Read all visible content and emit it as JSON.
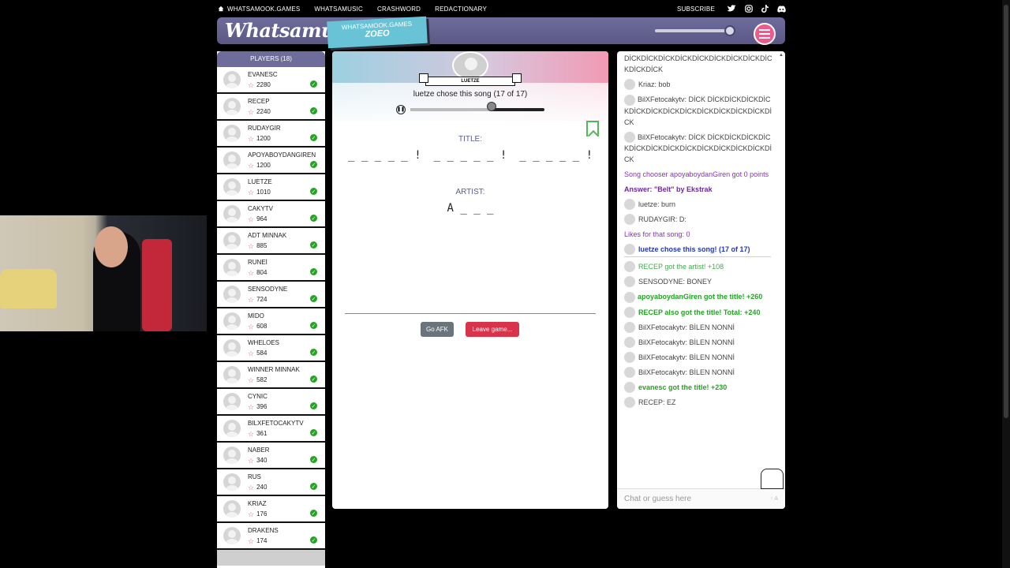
{
  "topnav": {
    "items": [
      "WHATSAMOOK.GAMES",
      "WHATSAMUSIC",
      "CRASHWORD",
      "REDACTIONARY"
    ],
    "subscribe": "SUBSCRIBE",
    "socials": [
      "twitter-icon",
      "instagram-icon",
      "tiktok-icon",
      "discord-icon"
    ]
  },
  "header": {
    "logo": "Whatsamusic",
    "tag_line1": "WHATSAMOOK.GAMES",
    "tag_line2": "ZOEO"
  },
  "players": {
    "title": "PLAYERS (18)",
    "list": [
      {
        "name": "EVANESC",
        "score": "2280"
      },
      {
        "name": "RECEP",
        "score": "2240"
      },
      {
        "name": "RUDAYGIR",
        "score": "1200"
      },
      {
        "name": "APOYABOYDANGIREN",
        "score": "1200"
      },
      {
        "name": "LUETZE",
        "score": "1010"
      },
      {
        "name": "CAKYTV",
        "score": "964"
      },
      {
        "name": "ADT MINNAK",
        "score": "885"
      },
      {
        "name": "RUNEİ",
        "score": "804"
      },
      {
        "name": "SENSODYNE",
        "score": "724"
      },
      {
        "name": "MIDO",
        "score": "608"
      },
      {
        "name": "WHELOES",
        "score": "584"
      },
      {
        "name": "WINNER MINNAK",
        "score": "582"
      },
      {
        "name": "CYNIC",
        "score": "396"
      },
      {
        "name": "BILXFETOCAKYTV",
        "score": "361"
      },
      {
        "name": "NABER",
        "score": "340"
      },
      {
        "name": "RUS",
        "score": "240"
      },
      {
        "name": "KRIAZ",
        "score": "176"
      },
      {
        "name": "DRAKENS",
        "score": "174"
      }
    ]
  },
  "game": {
    "chooser_ribbon": "LUETZE",
    "chose_text": "luetze chose this song (17 of 17)",
    "progress_fraction": 0.61,
    "title_label": "TITLE:",
    "title_hint": [
      "_ _ _ _ _ !",
      "_ _ _ _ _ !",
      "_ _ _ _ _ !"
    ],
    "artist_label": "ARTIST:",
    "artist_hint": "A _ _ _",
    "afk_label": "Go AFK",
    "leave_label": "Leave game..."
  },
  "chat": {
    "spam1": "DİCKDİCKDİCKDİCKDİCKDİCKDİCKDİCKDİCKDİCKDİCK",
    "kriaz": "Kriaz: bob",
    "bilx1": "BilXFetocakytv: DİCK DİCKDİCKDİCKDİCKDİCKDİCKDİCKDİCKDİCKDİCKDİCKDİCKDİCK",
    "bilx2": "BilXFetocakytv: DİCK DİCKDİCKDİCKDİCKDİCKDİCKDİCKDİCKDİCKDİCKDİCKDİCKDİCK",
    "song_chooser": "Song chooser apoyaboydanGiren got 0 points",
    "answer": "Answer: \"Belt\" by Ekstrak",
    "luetze": "luetze: burn",
    "rudaygir": "RUDAYGIR: D:",
    "likes": "Likes for that song: 0",
    "chose": "luetze chose this song! (17 of 17)",
    "recep_artist": "RECEP got the artist! +108",
    "sensodyne": "SENSODYNE: BONEY",
    "apoya_title": "apoyaboydanGiren got the title! +260",
    "recep_title": "RECEP also got the title! Total: +240",
    "bilen1": "BilXFetocakytv: BİLEN NONNİ",
    "bilen2": "BilXFetocakytv: BİLEN NONNİ",
    "bilen3": "BilXFetocakytv: BİLEN NONNİ",
    "bilen4": "BilXFetocakytv: BİLEN NONNİ",
    "evanesc_title": "evanesc got the title! +230",
    "recep_ez": "RECEP: EZ",
    "input_placeholder": "Chat or guess here",
    "input_hint": "↑ A"
  },
  "colors": {
    "header_purple": "#6e6c9a",
    "accent_pink": "#ef5a8c",
    "leave_red": "#d8334a",
    "afk_gray": "#6b747c",
    "success_green": "#23a423"
  }
}
